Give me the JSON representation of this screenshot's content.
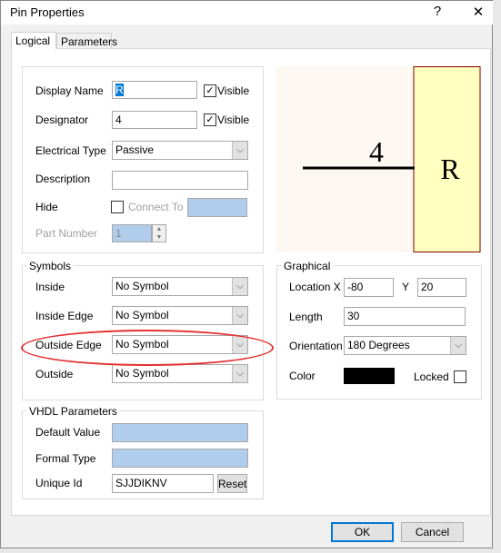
{
  "window": {
    "title": "Pin Properties",
    "help": "?",
    "close": "✕"
  },
  "tabs": [
    {
      "label": "Logical"
    },
    {
      "label": "Parameters"
    }
  ],
  "properties": {
    "display_name_label": "Display Name",
    "display_name_value": "R",
    "display_visible_label": "Visible",
    "display_visible_checked": true,
    "designator_label": "Designator",
    "designator_value": "4",
    "designator_visible_label": "Visible",
    "designator_visible_checked": true,
    "electrical_type_label": "Electrical Type",
    "electrical_type_value": "Passive",
    "description_label": "Description",
    "description_value": "",
    "hide_label": "Hide",
    "hide_checked": false,
    "connect_to_label": "Connect To",
    "part_number_label": "Part Number",
    "part_number_value": "1"
  },
  "preview": {
    "designator": "4",
    "name": "R",
    "body_color": "#ffffc0",
    "border_color": "#800000"
  },
  "symbols": {
    "title": "Symbols",
    "rows": [
      {
        "label": "Inside",
        "value": "No Symbol"
      },
      {
        "label": "Inside Edge",
        "value": "No Symbol"
      },
      {
        "label": "Outside Edge",
        "value": "No Symbol"
      },
      {
        "label": "Outside",
        "value": "No Symbol"
      }
    ]
  },
  "graphical": {
    "title": "Graphical",
    "location_label": "Location X",
    "x_value": "-80",
    "y_label": "Y",
    "y_value": "20",
    "length_label": "Length",
    "length_value": "30",
    "orientation_label": "Orientation",
    "orientation_value": "180 Degrees",
    "color_label": "Color",
    "color_value": "#000000",
    "locked_label": "Locked",
    "locked_checked": false
  },
  "vhdl": {
    "title": "VHDL Parameters",
    "default_value_label": "Default Value",
    "formal_type_label": "Formal Type",
    "unique_id_label": "Unique Id",
    "unique_id_value": "SJJDIKNV",
    "reset_label": "Reset"
  },
  "buttons": {
    "ok": "OK",
    "cancel": "Cancel"
  },
  "annotation_color": "#e53030"
}
